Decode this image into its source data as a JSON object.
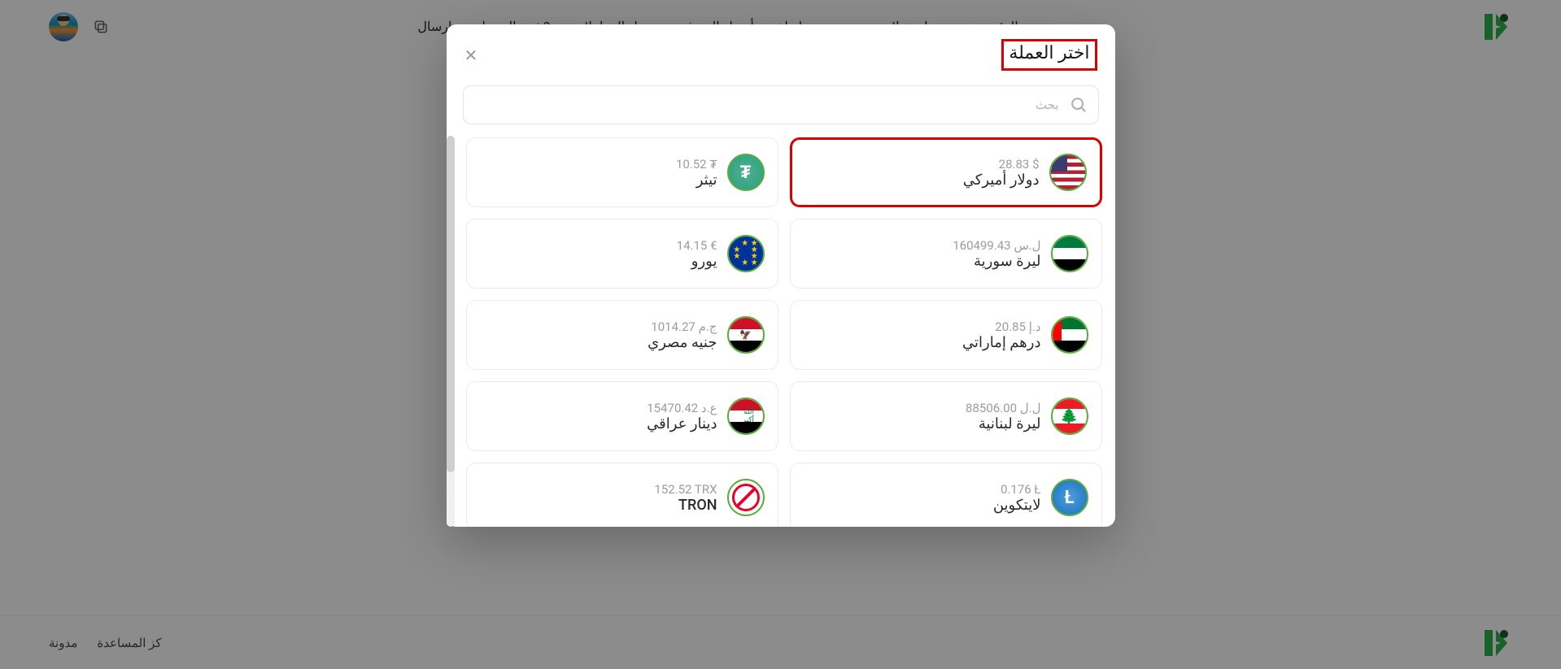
{
  "nav": {
    "items": [
      "الرئيسية",
      "تحويل عملات",
      "سحب",
      "إيداع",
      "أسعار الصرف",
      "سجل المعاملات",
      "?تثبت التحويلة",
      "إرسال"
    ]
  },
  "modal": {
    "title": "اختر العملة",
    "search_placeholder": "بحث"
  },
  "currencies": [
    {
      "name": "دولار أميركي",
      "amount": "28.83 $",
      "flag": "us",
      "highlight": true
    },
    {
      "name": "تيثر",
      "amount": "10.52 ₮",
      "flag": "usdt",
      "highlight": false
    },
    {
      "name": "ليرة سورية",
      "amount": "160499.43 ل.س",
      "flag": "syp",
      "highlight": false
    },
    {
      "name": "يورو",
      "amount": "14.15 €",
      "flag": "eur",
      "highlight": false
    },
    {
      "name": "درهم إماراتي",
      "amount": "20.85 د.إ",
      "flag": "aed",
      "highlight": false
    },
    {
      "name": "جنيه مصري",
      "amount": "1014.27 ج.م",
      "flag": "egp",
      "highlight": false
    },
    {
      "name": "ليرة لبنانية",
      "amount": "88506.00 ل.ل",
      "flag": "lbp",
      "highlight": false
    },
    {
      "name": "دينار عراقي",
      "amount": "15470.42 ع.د",
      "flag": "iqd",
      "highlight": false
    },
    {
      "name": "لايتكوين",
      "amount": "0.176 Ł",
      "flag": "ltc",
      "highlight": false
    },
    {
      "name": "TRON",
      "amount": "152.52 TRX",
      "flag": "trx",
      "highlight": false
    }
  ],
  "footer": {
    "links": [
      "مدونة",
      "كز المساعدة"
    ]
  }
}
